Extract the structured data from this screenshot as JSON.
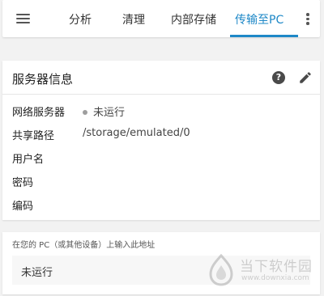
{
  "toolbar": {
    "tabs": [
      {
        "label": "分析"
      },
      {
        "label": "清理"
      },
      {
        "label": "内部存储"
      },
      {
        "label": "传输至PC",
        "selected": true
      }
    ],
    "accent_color": "#1e88c7"
  },
  "server_card": {
    "title": "服务器信息",
    "help_icon_glyph": "?",
    "rows": [
      {
        "label": "网络服务器",
        "value": "未运行",
        "status": "stopped"
      },
      {
        "label": "共享路径",
        "value": "/storage/emulated/0"
      },
      {
        "label": "用户名",
        "value": ""
      },
      {
        "label": "密码",
        "value": ""
      },
      {
        "label": "编码",
        "value": ""
      }
    ]
  },
  "address_card": {
    "hint": "在您的 PC（或其他设备）上输入此地址",
    "value": "未运行"
  },
  "watermark": {
    "text": "当下软件园",
    "url": "www.downxia.com"
  }
}
